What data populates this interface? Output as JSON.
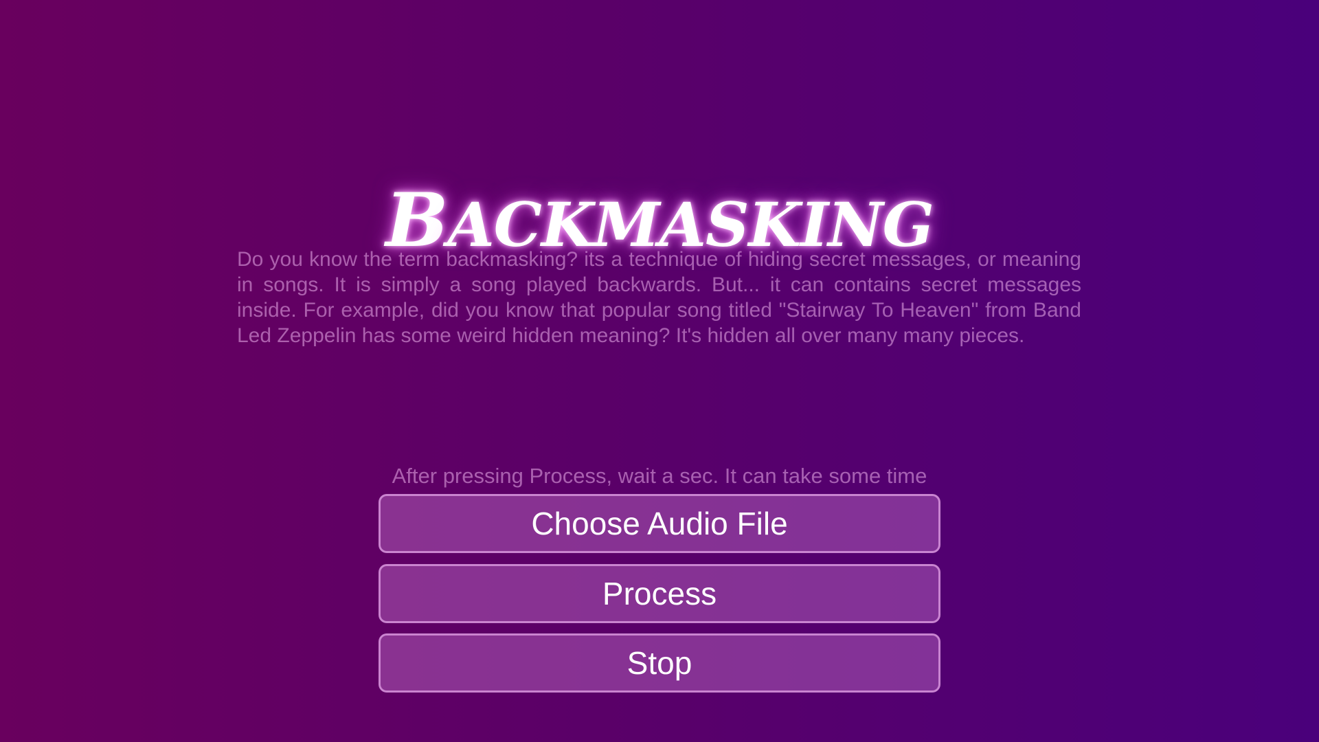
{
  "header": {
    "title": "Backmasking"
  },
  "intro": {
    "text": "Do you know the term backmasking? its a technique of hiding secret messages, or meaning in songs. It is simply a song played backwards. But... it can contains secret messages inside. For example, did you know that popular song titled \"Stairway To Heaven\" from Band Led Zeppelin has some weird hidden meaning? It's hidden all over many many pieces."
  },
  "controls": {
    "hint": "After pressing Process, wait a sec. It can take some time",
    "choose_label": "Choose Audio File",
    "process_label": "Process",
    "stop_label": "Stop"
  },
  "colors": {
    "background_left": "#69005e",
    "background_right": "#4a007b",
    "button_fill": "#9a4fa8",
    "button_border": "#e1a0e6",
    "title_glow": "#f05aff"
  }
}
